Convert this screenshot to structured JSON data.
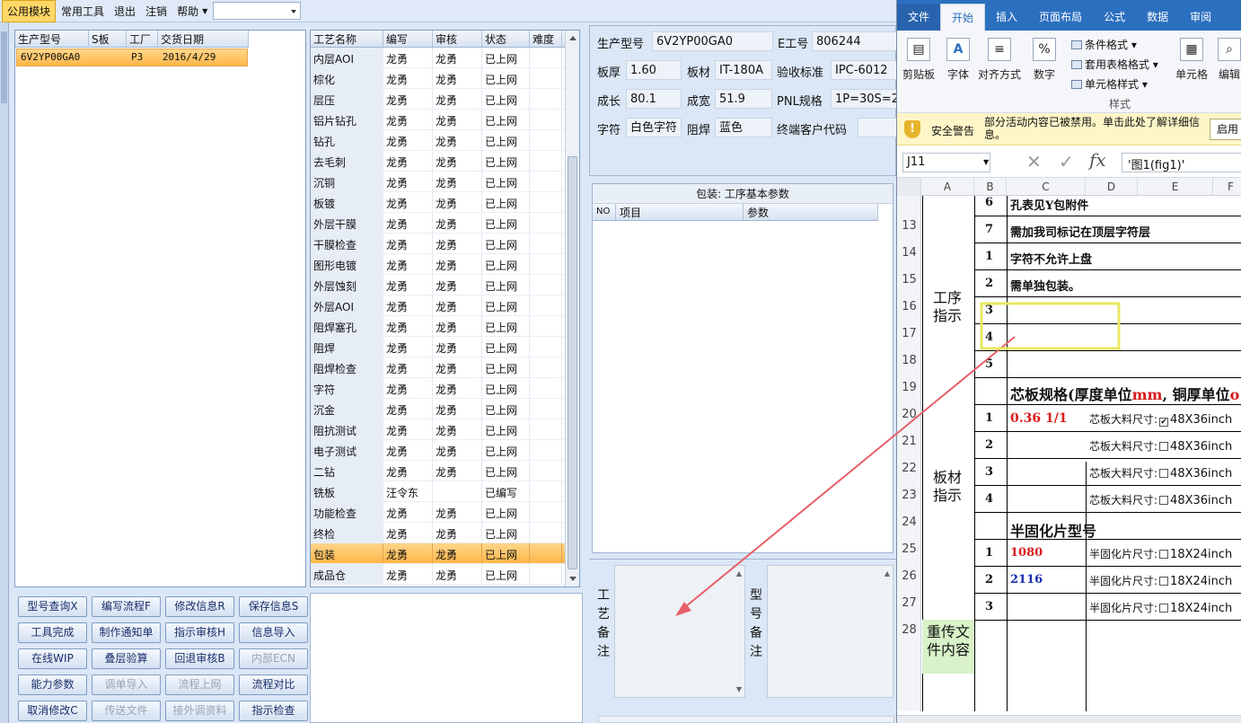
{
  "menu": {
    "items": [
      "公用模块",
      "常用工具",
      "退出",
      "注销",
      "帮助"
    ]
  },
  "model_table": {
    "columns": [
      "生产型号",
      "S板",
      "工厂",
      "交货日期"
    ],
    "rows": [
      [
        "6V2YP00GA0",
        "",
        "P3",
        "2016/4/29"
      ]
    ]
  },
  "process_table": {
    "columns": [
      "工艺名称",
      "编写",
      "审核",
      "状态",
      "难度"
    ],
    "rows": [
      [
        "内层AOI",
        "龙勇",
        "龙勇",
        "已上网",
        ""
      ],
      [
        "棕化",
        "龙勇",
        "龙勇",
        "已上网",
        ""
      ],
      [
        "层压",
        "龙勇",
        "龙勇",
        "已上网",
        ""
      ],
      [
        "铝片钻孔",
        "龙勇",
        "龙勇",
        "已上网",
        ""
      ],
      [
        "钻孔",
        "龙勇",
        "龙勇",
        "已上网",
        ""
      ],
      [
        "去毛刺",
        "龙勇",
        "龙勇",
        "已上网",
        ""
      ],
      [
        "沉铜",
        "龙勇",
        "龙勇",
        "已上网",
        ""
      ],
      [
        "板镀",
        "龙勇",
        "龙勇",
        "已上网",
        ""
      ],
      [
        "外层干膜",
        "龙勇",
        "龙勇",
        "已上网",
        ""
      ],
      [
        "干膜检查",
        "龙勇",
        "龙勇",
        "已上网",
        ""
      ],
      [
        "图形电镀",
        "龙勇",
        "龙勇",
        "已上网",
        ""
      ],
      [
        "外层蚀刻",
        "龙勇",
        "龙勇",
        "已上网",
        ""
      ],
      [
        "外层AOI",
        "龙勇",
        "龙勇",
        "已上网",
        ""
      ],
      [
        "阻焊塞孔",
        "龙勇",
        "龙勇",
        "已上网",
        ""
      ],
      [
        "阻焊",
        "龙勇",
        "龙勇",
        "已上网",
        ""
      ],
      [
        "阻焊检查",
        "龙勇",
        "龙勇",
        "已上网",
        ""
      ],
      [
        "字符",
        "龙勇",
        "龙勇",
        "已上网",
        ""
      ],
      [
        "沉金",
        "龙勇",
        "龙勇",
        "已上网",
        ""
      ],
      [
        "阻抗测试",
        "龙勇",
        "龙勇",
        "已上网",
        ""
      ],
      [
        "电子测试",
        "龙勇",
        "龙勇",
        "已上网",
        ""
      ],
      [
        "二钻",
        "龙勇",
        "龙勇",
        "已上网",
        ""
      ],
      [
        "铣板",
        "汪令东",
        "",
        "已编写",
        ""
      ],
      [
        "功能检查",
        "龙勇",
        "龙勇",
        "已上网",
        ""
      ],
      [
        "终检",
        "龙勇",
        "龙勇",
        "已上网",
        ""
      ],
      [
        "包装",
        "龙勇",
        "龙勇",
        "已上网",
        ""
      ],
      [
        "成品仓",
        "龙勇",
        "龙勇",
        "已上网",
        ""
      ]
    ],
    "selected_index": 24
  },
  "buttons": [
    [
      "型号查询X",
      "编写流程F",
      "修改信息R",
      "保存信息S"
    ],
    [
      "工具完成",
      "制作通知单",
      "指示审核H",
      "信息导入"
    ],
    [
      "在线WIP",
      "叠层验算",
      "回退审核B",
      "内部ECN"
    ],
    [
      "能力参数",
      "调单导入",
      "流程上网",
      "流程对比"
    ],
    [
      "取消修改C",
      "传送文件",
      "接外调资料",
      "指示检查"
    ]
  ],
  "info": {
    "model_label": "生产型号",
    "model_value": "6V2YP00GA0",
    "eno_label": "E工号",
    "eno_value": "806244",
    "thickness_label": "板厚",
    "thickness_value": "1.60",
    "material_label": "板材",
    "material_value": "IT-180A",
    "standard_label": "验收标准",
    "standard_value": "IPC-6012",
    "length_label": "成长",
    "length_value": "80.1",
    "width_label": "成宽",
    "width_value": "51.9",
    "pnl_label": "PNL规格",
    "pnl_value": "1P=30S=2",
    "char_label": "字符",
    "char_value": "白色字符",
    "mask_label": "阻焊",
    "mask_value": "蓝色",
    "customer_label": "终端客户代码",
    "customer_value": ""
  },
  "params": {
    "title": "包装: 工序基本参数",
    "columns": [
      "NO",
      "项目",
      "参数"
    ]
  },
  "notes": {
    "process_note_label": "工艺备注",
    "model_note_label": "型号备注"
  },
  "excel": {
    "tabs": [
      "文件",
      "开始",
      "插入",
      "页面布局",
      "公式",
      "数据",
      "审阅"
    ],
    "ribbon": {
      "clipboard": "剪贴板",
      "font": "字体",
      "align": "对齐方式",
      "number": "数字",
      "cond_format": "条件格式",
      "table_format": "套用表格格式",
      "cell_style": "单元格样式",
      "styles_group": "样式",
      "cells": "单元格",
      "edit": "编辑"
    },
    "security": {
      "title": "安全警告",
      "message": "部分活动内容已被禁用。单击此处了解详细信息。",
      "enable": "启用"
    },
    "namebox": "J11",
    "formula": "'图1(fig1)'",
    "columns": [
      "A",
      "B",
      "C",
      "D",
      "E",
      "F"
    ],
    "row_numbers": [
      "13",
      "14",
      "15",
      "16",
      "17",
      "18",
      "19",
      "20",
      "21",
      "22",
      "23",
      "24",
      "25",
      "26",
      "27",
      "28"
    ],
    "cells": {
      "r13_no": "6",
      "r13_text": "孔表见Y包附件",
      "r14_no": "7",
      "r14_text": "需加我司标记在顶层字符层",
      "r15_no": "1",
      "r15_text": "字符不允许上盘",
      "r16_no": "2",
      "r16_text": "需单独包装。",
      "r17_no": "3",
      "r18_no": "4",
      "r19_no": "5",
      "proc_label": "工序指示",
      "core_header_a": "芯板规格(厚度单位",
      "core_header_mm": "mm",
      "core_header_b": ", 铜厚单位",
      "core_header_o": "o",
      "r21_no": "1",
      "r21_spec": "0.36 1/1",
      "core_size_label": "芯板大料尺寸:",
      "core_size": "48X36inch",
      "r22_no": "2",
      "r23_no": "3",
      "r24_no": "4",
      "material_label": "板材指示",
      "prepreg_header": "半固化片型号",
      "r26_no": "1",
      "r26_type": "1080",
      "r27_no": "2",
      "r27_type": "2116",
      "r28_no": "3",
      "prepreg_size_label": "半固化片尺寸:",
      "prepreg_size": "18X24inch",
      "resend_label": "重传文件内容"
    }
  },
  "colors": {
    "menu_active": "#ffd766",
    "selection": "#ffb648",
    "excel_blue": "#2b6fbf",
    "annotation_red": "#e8606a",
    "highlight_box": "#e9e860"
  }
}
